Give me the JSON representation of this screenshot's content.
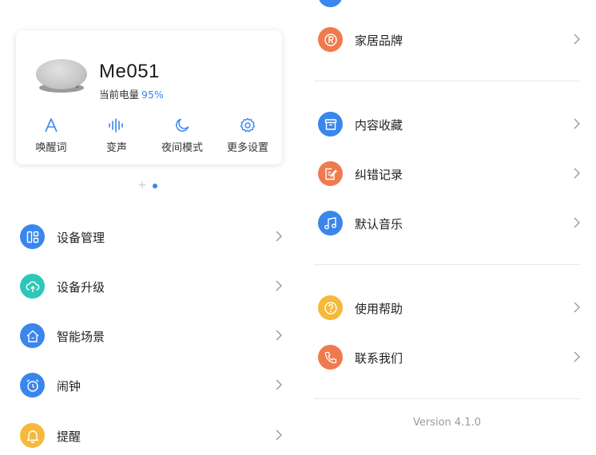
{
  "device": {
    "name": "Me051",
    "battery_label": "当前电量",
    "battery_value": "95%",
    "actions": [
      {
        "label": "唤醒词",
        "icon": "letter-a-icon"
      },
      {
        "label": "变声",
        "icon": "voice-wave-icon"
      },
      {
        "label": "夜间模式",
        "icon": "moon-icon"
      },
      {
        "label": "更多设置",
        "icon": "gear-icon"
      }
    ]
  },
  "pager": {
    "current": 2,
    "total": 2
  },
  "left_menu": [
    {
      "label": "设备管理",
      "icon": "device-grid-icon",
      "color": "#3a86ec"
    },
    {
      "label": "设备升级",
      "icon": "cloud-upload-icon",
      "color": "#2dc7b8"
    },
    {
      "label": "智能场景",
      "icon": "smart-home-icon",
      "color": "#3a86ec"
    },
    {
      "label": "闹钟",
      "icon": "alarm-clock-icon",
      "color": "#3a86ec"
    },
    {
      "label": "提醒",
      "icon": "bell-icon",
      "color": "#f5b93b"
    }
  ],
  "right_menu": {
    "group1": [
      {
        "label": "家居品牌",
        "icon": "registered-brand-icon",
        "color": "#f07a4f"
      }
    ],
    "group2": [
      {
        "label": "内容收藏",
        "icon": "archive-box-icon",
        "color": "#3a86ec"
      },
      {
        "label": "纠错记录",
        "icon": "edit-note-icon",
        "color": "#f07a4f"
      },
      {
        "label": "默认音乐",
        "icon": "music-note-icon",
        "color": "#3a86ec"
      }
    ],
    "group3": [
      {
        "label": "使用帮助",
        "icon": "help-question-icon",
        "color": "#f5b93b"
      },
      {
        "label": "联系我们",
        "icon": "phone-icon",
        "color": "#f07a4f"
      }
    ]
  },
  "version": "Version 4.1.0",
  "colors": {
    "accent": "#3a86ec",
    "teal": "#2dc7b8",
    "orange": "#f07a4f",
    "yellow": "#f5b93b"
  }
}
